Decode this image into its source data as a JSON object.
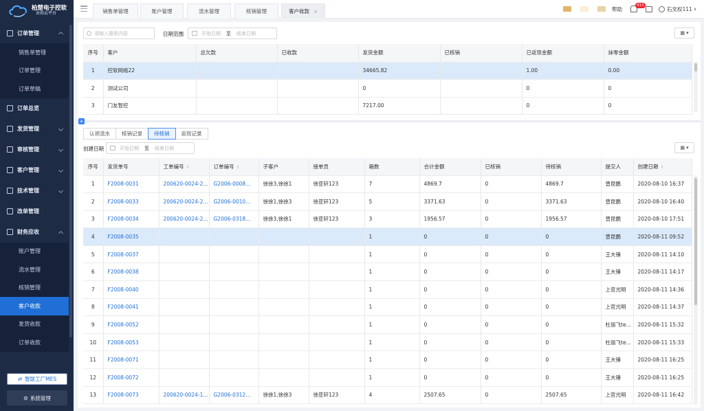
{
  "brand": {
    "title": "柏楚电子控软",
    "subtitle": "采购云平台"
  },
  "sidebar": {
    "items": [
      {
        "label": "订单管理",
        "type": "section",
        "expanded": true,
        "icon": "order-icon"
      },
      {
        "label": "销售单管理",
        "type": "sub"
      },
      {
        "label": "订单管理",
        "type": "sub"
      },
      {
        "label": "订单草稿",
        "type": "sub"
      },
      {
        "label": "订单总览",
        "type": "section",
        "icon": "overview-icon"
      },
      {
        "label": "发货管理",
        "type": "section",
        "expanded": false,
        "icon": "shipping-icon"
      },
      {
        "label": "审核管理",
        "type": "section",
        "expanded": false,
        "icon": "audit-icon"
      },
      {
        "label": "客户管理",
        "type": "section",
        "expanded": false,
        "icon": "customer-icon"
      },
      {
        "label": "技术管理",
        "type": "section",
        "expanded": false,
        "icon": "tech-icon"
      },
      {
        "label": "改单管理",
        "type": "section",
        "icon": "change-icon"
      },
      {
        "label": "财务应收",
        "type": "section",
        "expanded": true,
        "icon": "finance-icon"
      },
      {
        "label": "账户管理",
        "type": "sub"
      },
      {
        "label": "流水管理",
        "type": "sub"
      },
      {
        "label": "核销管理",
        "type": "sub"
      },
      {
        "label": "客户收款",
        "type": "sub",
        "active": true
      },
      {
        "label": "发货收款",
        "type": "sub"
      },
      {
        "label": "订单收款",
        "type": "sub"
      }
    ],
    "mes_button": "智联工厂MES",
    "system_button": "系统管理"
  },
  "topbar": {
    "tabs": [
      "销售单管理",
      "账户管理",
      "流水管理",
      "核销管理",
      "客户收款"
    ],
    "active_tab": "客户收款",
    "help": "帮助",
    "notification_count": "413",
    "user": "石文权111"
  },
  "filters": {
    "search_placeholder": "请输入搜索内容",
    "date_range_label": "日期范围",
    "start_placeholder": "开始日期",
    "to": "至",
    "end_placeholder": "结束日期",
    "created_label": "创建日期"
  },
  "top_table": {
    "headers": [
      "序号",
      "客户",
      "总欠款",
      "已收款",
      "发货金额",
      "已核销",
      "已返现金额",
      "抹零金额"
    ],
    "rows": [
      [
        "1",
        "控软网络22",
        "",
        "",
        "34665.82",
        "",
        "1.00",
        "0.00"
      ],
      [
        "2",
        "测试公司",
        "",
        "",
        "0",
        "",
        "0",
        "0"
      ],
      [
        "3",
        "门友智控",
        "",
        "",
        "7217.00",
        "",
        "0",
        "0"
      ]
    ],
    "selected_row": 0
  },
  "subtabs": [
    "认领流水",
    "核销记录",
    "待核销",
    "返现记录"
  ],
  "active_subtab": "待核销",
  "bottom_table": {
    "headers": [
      "序号",
      "发货单号",
      "工单编号",
      "订单编号",
      "子客户",
      "接单员",
      "箱数",
      "合计金额",
      "已核销",
      "待核销",
      "提交人",
      "创建日期"
    ],
    "sortable": [
      false,
      false,
      true,
      true,
      false,
      false,
      false,
      false,
      false,
      false,
      false,
      true
    ],
    "rows": [
      [
        "1",
        "F2008-0031",
        "200620-0024-2...",
        "G2006-0008...",
        "徐徐3,徐徐1",
        "徐亚轩123",
        "7",
        "4869.7",
        "0",
        "4869.7",
        "曾昆鹏",
        "2020-08-10 16:37"
      ],
      [
        "2",
        "F2008-0033",
        "200620-0024-2...",
        "G2006-0010...",
        "徐徐1,徐徐3",
        "徐亚轩123",
        "5",
        "3371.63",
        "0",
        "3371.63",
        "曾昆鹏",
        "2020-08-10 16:40"
      ],
      [
        "3",
        "F2008-0034",
        "200620-0024-2...",
        "G2006-0318...",
        "徐徐3,徐徐1",
        "徐亚轩123",
        "3",
        "1956.57",
        "0",
        "1956.57",
        "曾昆鹏",
        "2020-08-10 17:51"
      ],
      [
        "4",
        "F2008-0035",
        "",
        "",
        "",
        "",
        "1",
        "0",
        "0",
        "0",
        "曾昆鹏",
        "2020-08-11 09:52"
      ],
      [
        "5",
        "F2008-0037",
        "",
        "",
        "",
        "",
        "1",
        "0",
        "0",
        "0",
        "王大锤",
        "2020-08-11 14:10"
      ],
      [
        "6",
        "F2008-0038",
        "",
        "",
        "",
        "",
        "1",
        "0",
        "0",
        "0",
        "王大锤",
        "2020-08-11 14:17"
      ],
      [
        "7",
        "F2008-0040",
        "",
        "",
        "",
        "",
        "1",
        "0",
        "0",
        "0",
        "上官光明",
        "2020-08-11 14:36"
      ],
      [
        "8",
        "F2008-0041",
        "",
        "",
        "",
        "",
        "1",
        "0",
        "0",
        "0",
        "上官光明",
        "2020-08-11 14:37"
      ],
      [
        "9",
        "F2008-0052",
        "",
        "",
        "",
        "",
        "1",
        "0",
        "0",
        "0",
        "杜丽飞te...",
        "2020-08-11 15:32"
      ],
      [
        "10",
        "F2008-0053",
        "",
        "",
        "",
        "",
        "1",
        "0",
        "0",
        "0",
        "杜丽飞te...",
        "2020-08-11 15:33"
      ],
      [
        "11",
        "F2008-0071",
        "",
        "",
        "",
        "",
        "1",
        "0",
        "0",
        "0",
        "王大锤",
        "2020-08-11 16:25"
      ],
      [
        "12",
        "F2008-0072",
        "",
        "",
        "",
        "",
        "1",
        "0",
        "0",
        "0",
        "王大锤",
        "2020-08-11 16:25"
      ],
      [
        "13",
        "F2008-0073",
        "200620-0024-1...",
        "G2006-0312...",
        "徐徐1,徐徐3",
        "徐亚轩123",
        "4",
        "2507.65",
        "0",
        "2507.65",
        "上官光明",
        "2020-08-11 16:42"
      ]
    ],
    "selected_row": 3
  },
  "colors": {
    "sidebar_bg": "#1d2b45",
    "active_menu": "#1f6fd6",
    "selected_row": "#dbeafa",
    "link": "#1f6fd6",
    "badge": "#f5222d"
  }
}
